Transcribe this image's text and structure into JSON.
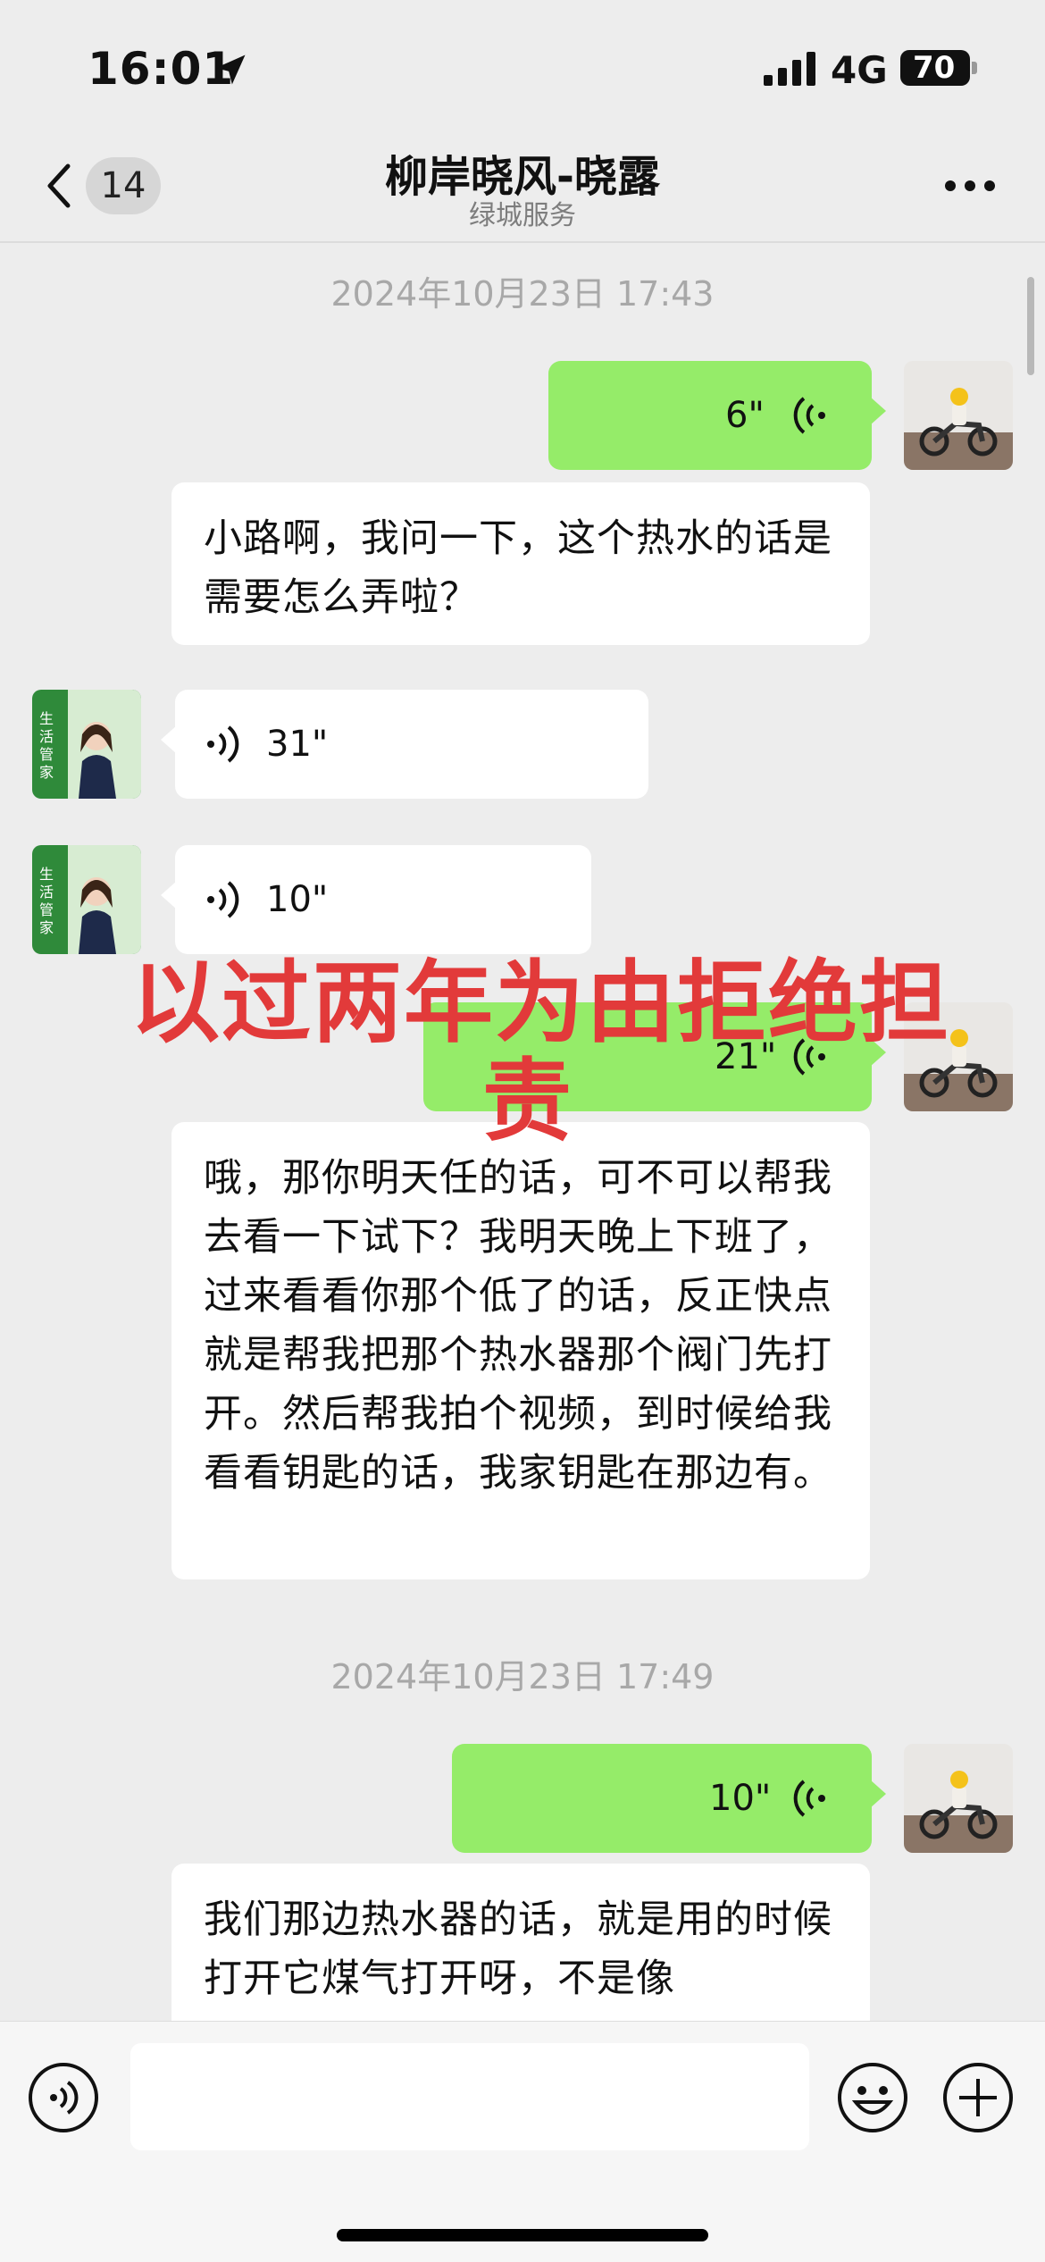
{
  "status_bar": {
    "time": "16:01",
    "network": "4G",
    "battery": "70"
  },
  "nav": {
    "unread_count": "14",
    "title": "柳岸晓风-晓露",
    "subtitle": "绿城服务"
  },
  "messages": [
    {
      "type": "timestamp",
      "text": "2024年10月23日 17:43"
    },
    {
      "type": "voice",
      "from": "me",
      "duration": "6\""
    },
    {
      "type": "transcript",
      "text": "小路啊，我问一下，这个热水的话是需要怎么弄啦？"
    },
    {
      "type": "voice",
      "from": "other",
      "duration": "31\""
    },
    {
      "type": "voice",
      "from": "other",
      "duration": "10\""
    },
    {
      "type": "voice",
      "from": "me",
      "duration": "21\""
    },
    {
      "type": "transcript",
      "text": "哦，那你明天任的话，可不可以帮我去看一下试下？我明天晚上下班了，过来看看你那个低了的话，反正快点就是帮我把那个热水器那个阀门先打开。然后帮我拍个视频，到时候给我看看钥匙的话，我家钥匙在那边有。"
    },
    {
      "type": "timestamp",
      "text": "2024年10月23日 17:49"
    },
    {
      "type": "voice",
      "from": "me",
      "duration": "10\""
    },
    {
      "type": "transcript",
      "text": "我们那边热水器的话，就是用的时候打开它煤气打开呀，不是像"
    }
  ],
  "other_avatar_label": "生活管家",
  "overlay": {
    "line1": "以过两年为由拒绝担",
    "line2": "责"
  },
  "icons": {
    "back": "chevron-left-icon",
    "more": "more-dots-icon",
    "voice_input": "voice-input-icon",
    "emoji": "emoji-icon",
    "add": "plus-icon"
  },
  "colors": {
    "background": "#ededed",
    "my_bubble": "#95ec69",
    "other_bubble": "#ffffff",
    "overlay_text": "#e23a3a"
  }
}
